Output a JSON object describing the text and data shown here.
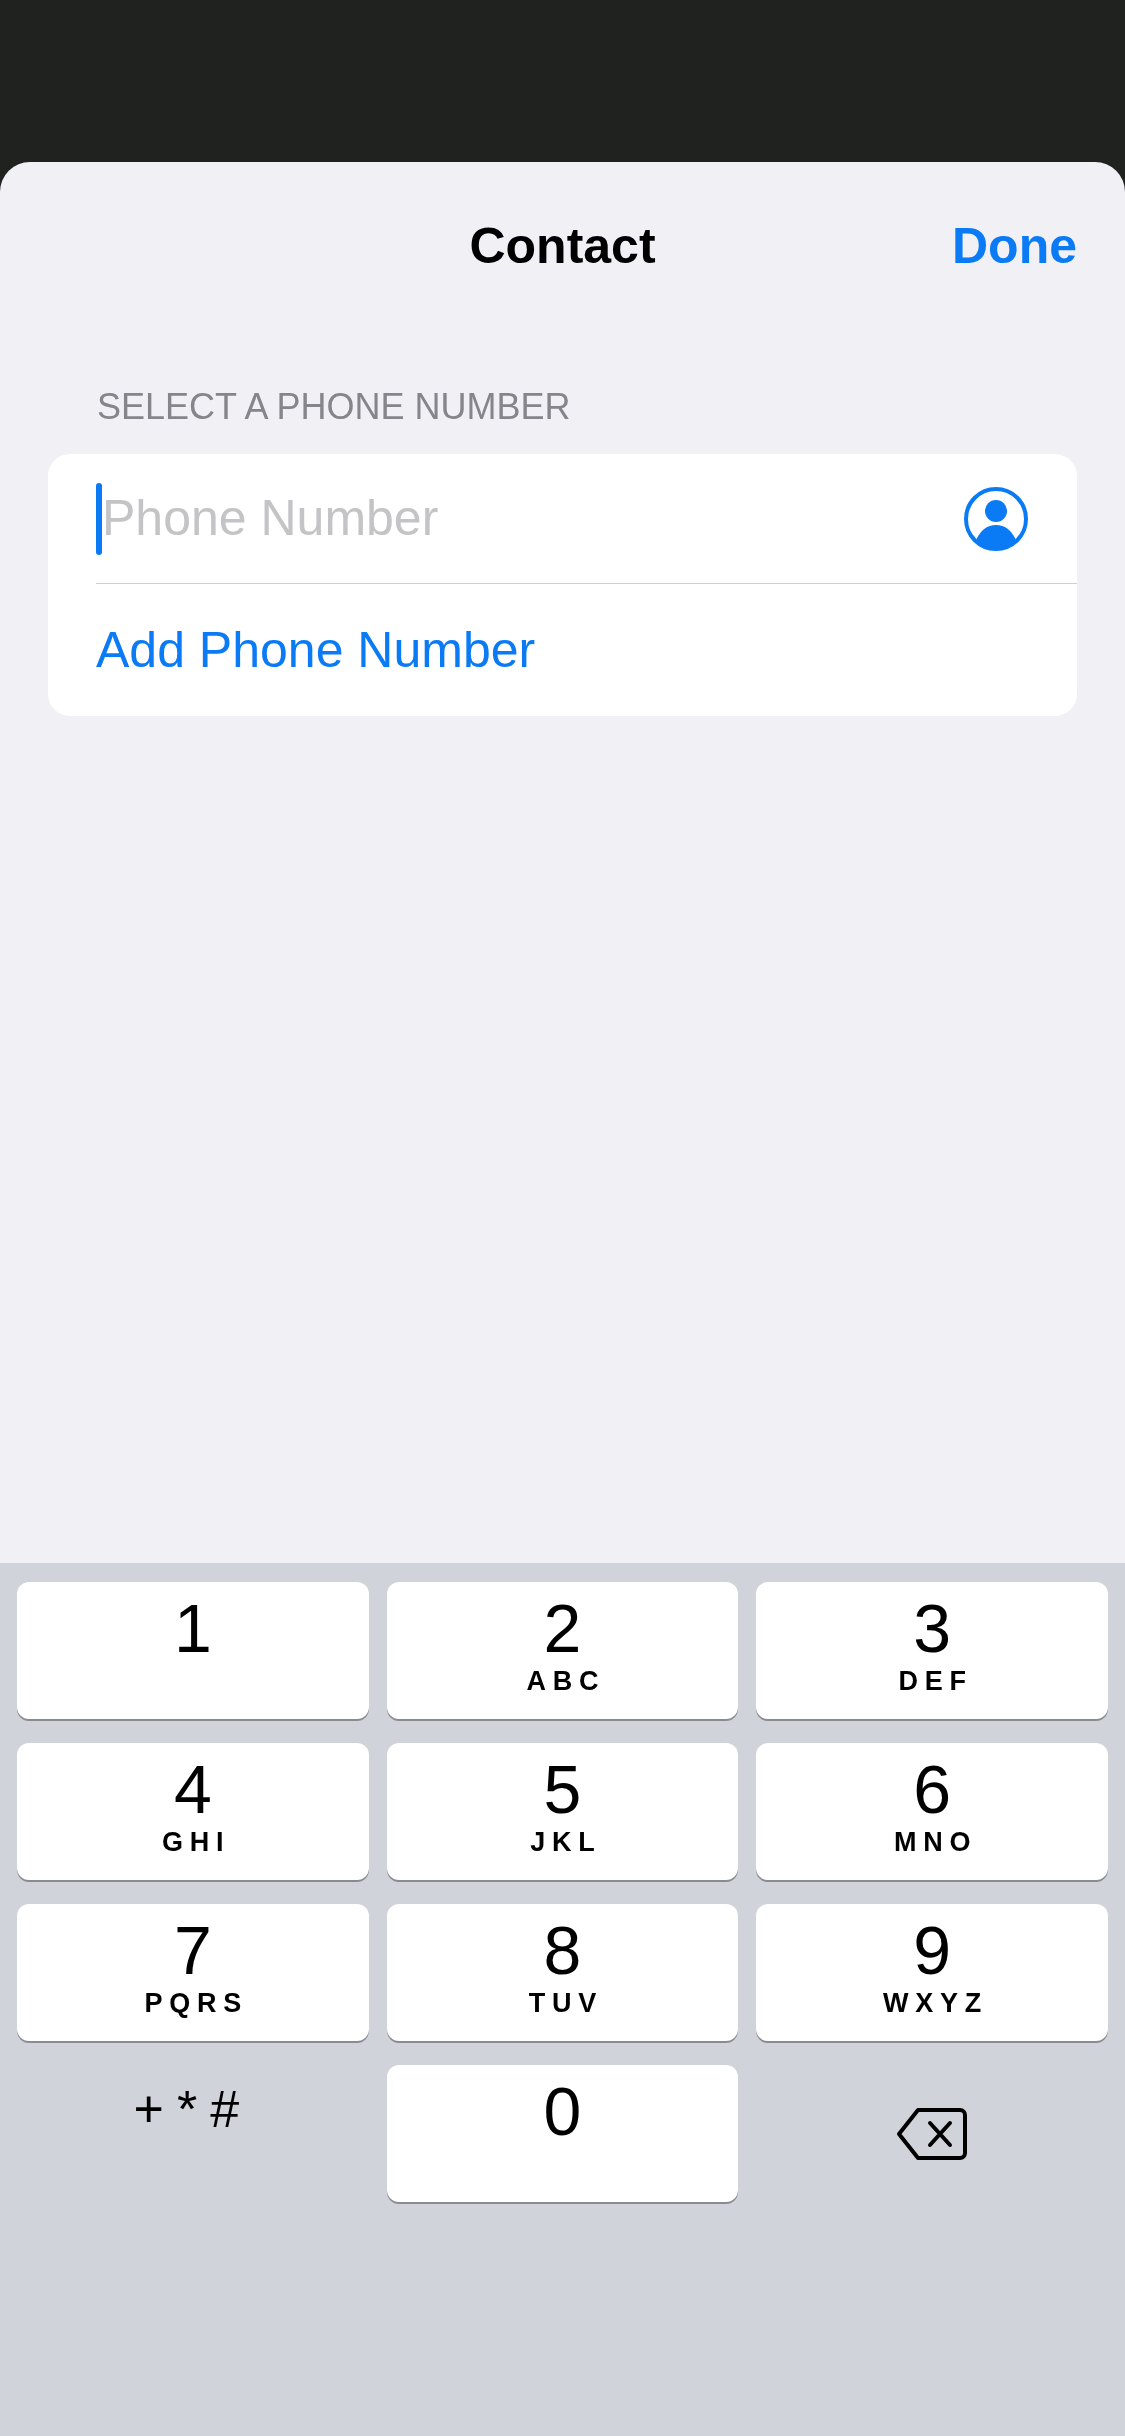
{
  "header": {
    "title": "Contact",
    "done": "Done"
  },
  "section": {
    "heading": "SELECT A PHONE NUMBER",
    "field": {
      "placeholder": "Phone Number",
      "focused": true
    },
    "add_link": "Add Phone Number"
  },
  "keypad": {
    "keys": [
      {
        "kind": "digit",
        "digit": "1"
      },
      {
        "kind": "digit",
        "digit": "2",
        "letters": "ABC"
      },
      {
        "kind": "digit",
        "digit": "3",
        "letters": "DEF"
      },
      {
        "kind": "digit",
        "digit": "4",
        "letters": "GHI"
      },
      {
        "kind": "digit",
        "digit": "5",
        "letters": "JKL"
      },
      {
        "kind": "digit",
        "digit": "6",
        "letters": "MNO"
      },
      {
        "kind": "digit",
        "digit": "7",
        "letters": "PQRS"
      },
      {
        "kind": "digit",
        "digit": "8",
        "letters": "TUV"
      },
      {
        "kind": "digit",
        "digit": "9",
        "letters": "WXYZ"
      },
      {
        "kind": "symbols",
        "label": "+*#"
      },
      {
        "kind": "digit",
        "digit": "0"
      },
      {
        "kind": "delete"
      }
    ]
  }
}
